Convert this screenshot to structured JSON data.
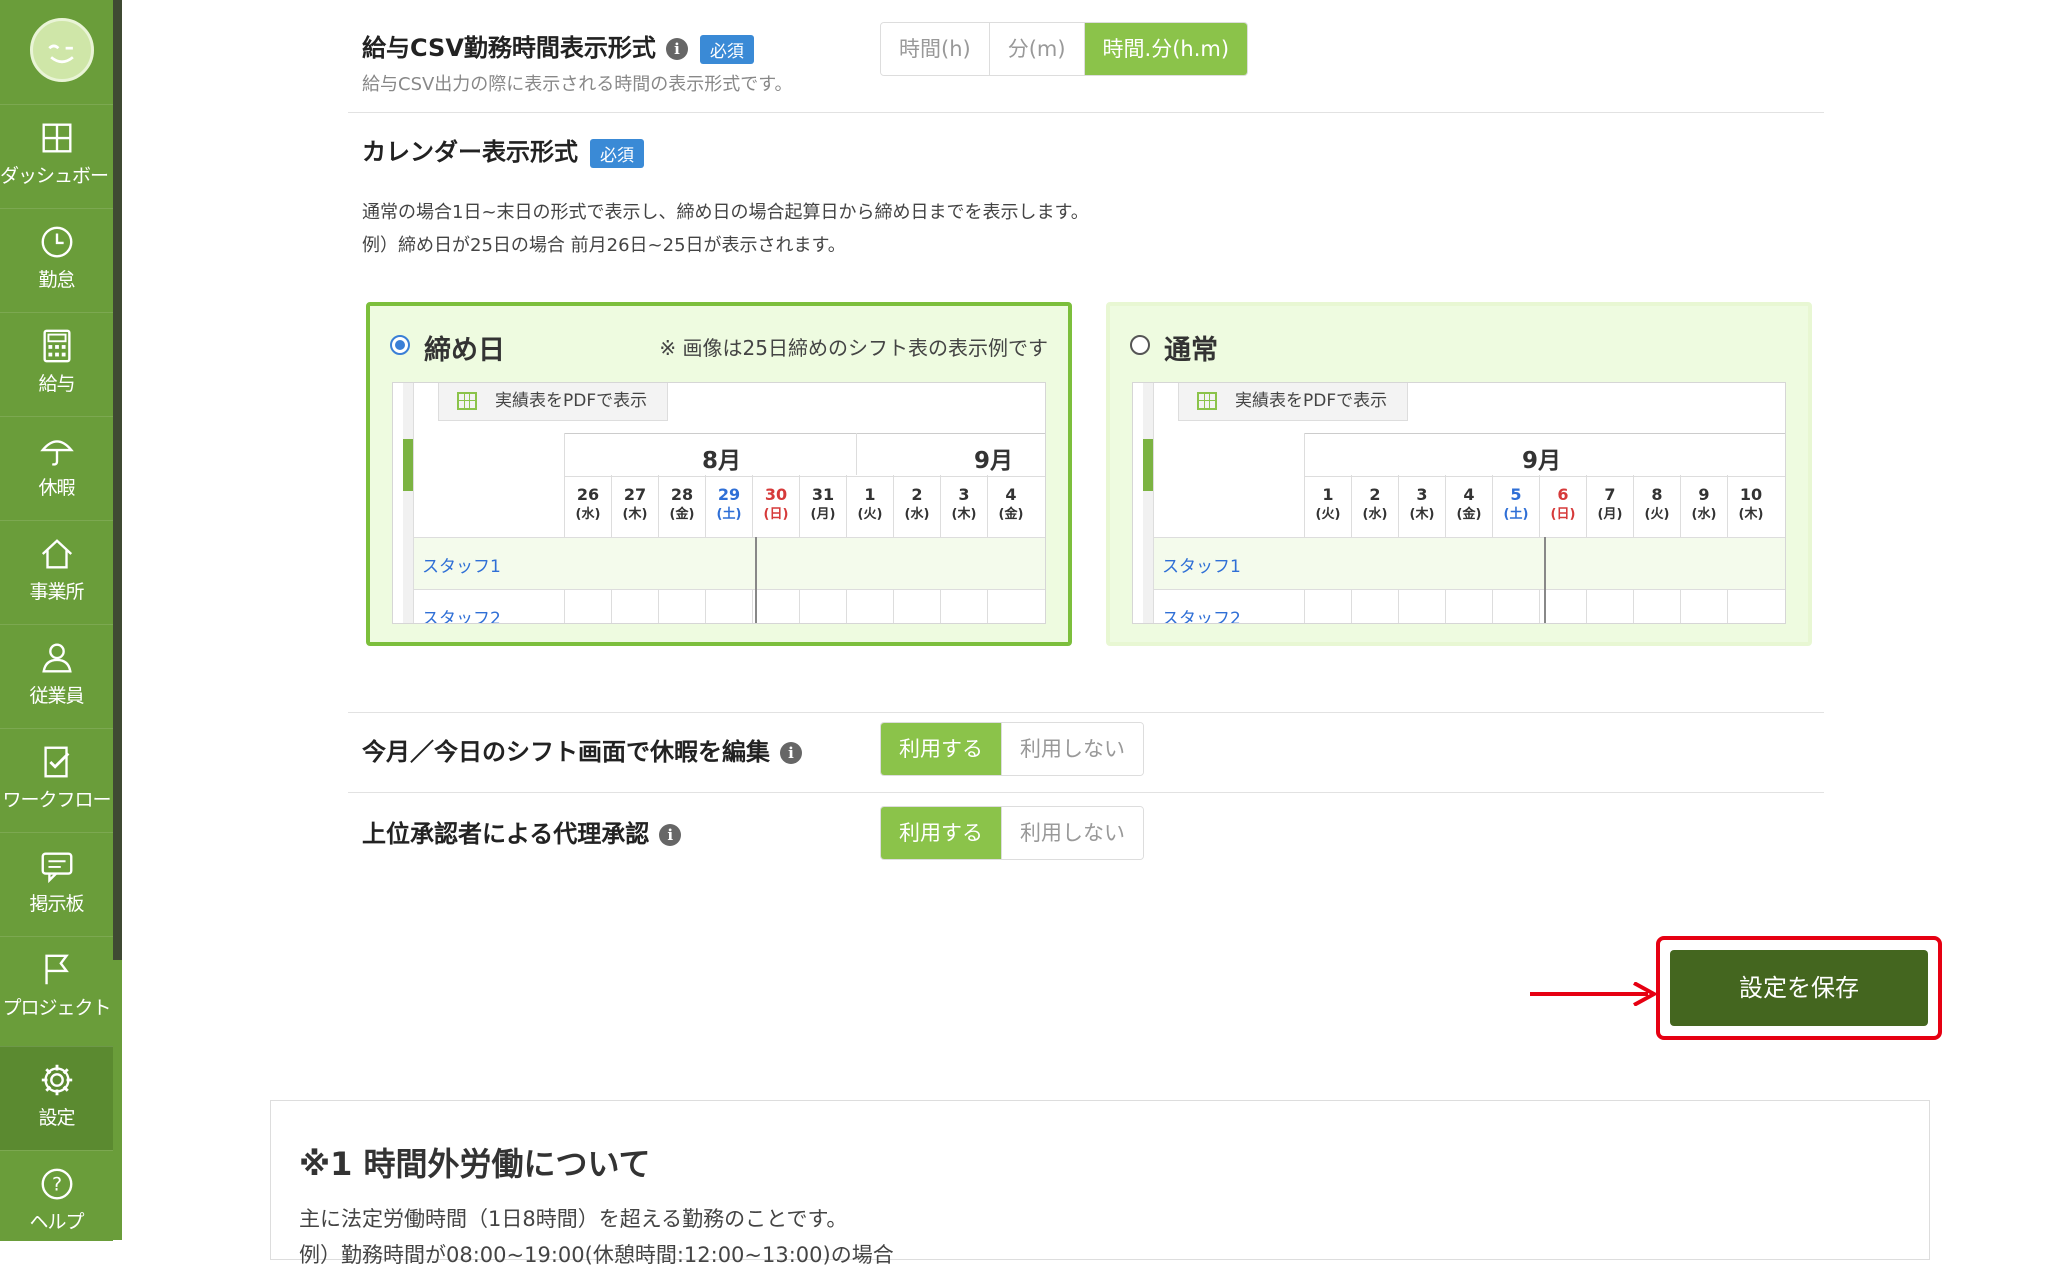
{
  "sidebar": {
    "items": [
      {
        "label": "ダッシュボード",
        "icon": "dashboard-icon"
      },
      {
        "label": "勤怠",
        "icon": "clock-icon"
      },
      {
        "label": "給与",
        "icon": "calculator-icon"
      },
      {
        "label": "休暇",
        "icon": "umbrella-icon"
      },
      {
        "label": "事業所",
        "icon": "home-icon"
      },
      {
        "label": "従業員",
        "icon": "person-icon"
      },
      {
        "label": "ワークフロー",
        "icon": "checklist-icon"
      },
      {
        "label": "掲示板",
        "icon": "message-icon"
      },
      {
        "label": "プロジェクト",
        "icon": "flag-icon"
      },
      {
        "label": "設定",
        "icon": "gear-icon"
      },
      {
        "label": "ヘルプ",
        "icon": "help-icon"
      }
    ]
  },
  "csv_format": {
    "title": "給与CSV勤務時間表示形式",
    "badge": "必須",
    "subtitle": "給与CSV出力の際に表示される時間の表示形式です。",
    "options": [
      "時間(h)",
      "分(m)",
      "時間.分(h.m)"
    ],
    "selected": "時間.分(h.m)"
  },
  "calendar_format": {
    "title": "カレンダー表示形式",
    "badge": "必須",
    "desc1": "通常の場合1日~末日の形式で表示し、締め日の場合起算日から締め日までを表示します。",
    "desc2": "例）締め日が25日の場合 前月26日~25日が表示されます。",
    "cards": {
      "closing": {
        "label": "締め日",
        "note": "※ 画像は25日締めのシフト表の表示例です",
        "pdf_button": "実績表をPDFで表示",
        "month1": "8月",
        "month2": "9月",
        "days": [
          "26",
          "27",
          "28",
          "29",
          "30",
          "31",
          "1",
          "2",
          "3",
          "4"
        ],
        "weekdays": [
          "(水)",
          "(木)",
          "(金)",
          "(土)",
          "(日)",
          "(月)",
          "(火)",
          "(水)",
          "(木)",
          "(金)"
        ],
        "staff1": "スタッフ1",
        "staff2": "スタッフ2"
      },
      "normal": {
        "label": "通常",
        "pdf_button": "実績表をPDFで表示",
        "month": "9月",
        "days": [
          "1",
          "2",
          "3",
          "4",
          "5",
          "6",
          "7",
          "8",
          "9",
          "10"
        ],
        "weekdays": [
          "(火)",
          "(水)",
          "(木)",
          "(金)",
          "(土)",
          "(日)",
          "(月)",
          "(火)",
          "(水)",
          "(木)"
        ],
        "staff1": "スタッフ1",
        "staff2": "スタッフ2"
      }
    },
    "selected": "締め日"
  },
  "leave_edit": {
    "title": "今月／今日のシフト画面で休暇を編集",
    "options": [
      "利用する",
      "利用しない"
    ],
    "selected": "利用する"
  },
  "proxy_approval": {
    "title": "上位承認者による代理承認",
    "options": [
      "利用する",
      "利用しない"
    ],
    "selected": "利用する"
  },
  "save_button": "設定を保存",
  "note": {
    "title": "※1 時間外労働について",
    "line1": "主に法定労働時間（1日8時間）を超える勤務のことです。",
    "line2": "例）勤務時間が08:00~19:00(休憩時間:12:00~13:00)の場合"
  },
  "colors": {
    "sidebar": "#6a9d3a",
    "accent": "#8bc34a",
    "save": "#44661f",
    "highlight": "#e60012",
    "badge": "#3a8ad6"
  }
}
